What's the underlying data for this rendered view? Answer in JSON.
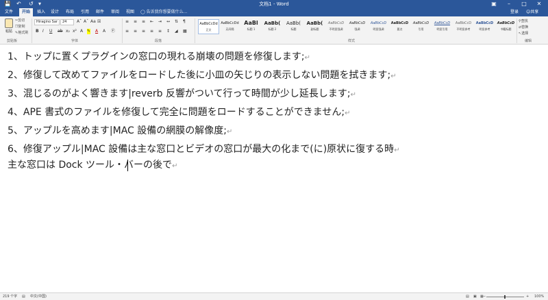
{
  "window": {
    "title": "文档1 - Word",
    "quick_access": [
      "save-icon",
      "undo-icon",
      "redo-icon",
      "customize-icon"
    ],
    "controls": [
      "ribbon-display-icon",
      "minimize-icon",
      "restore-icon",
      "close-icon"
    ]
  },
  "tabs": [
    {
      "label": "文件",
      "active": false
    },
    {
      "label": "开始",
      "active": true
    },
    {
      "label": "插入",
      "active": false
    },
    {
      "label": "设计",
      "active": false
    },
    {
      "label": "布局",
      "active": false
    },
    {
      "label": "引用",
      "active": false
    },
    {
      "label": "邮件",
      "active": false
    },
    {
      "label": "审阅",
      "active": false
    },
    {
      "label": "视图",
      "active": false
    }
  ],
  "tell_me": "告诉我你想要做什么...",
  "account": {
    "sign_in": "登录",
    "share": "共享"
  },
  "ribbon": {
    "clipboard": {
      "paste": "粘贴",
      "cut": "剪切",
      "copy": "复制",
      "format_painter": "格式刷",
      "label": "剪贴板"
    },
    "font": {
      "font_name": "Hiragino Sar",
      "font_size": "24",
      "label": "字体"
    },
    "paragraph": {
      "label": "段落"
    },
    "styles": {
      "label": "样式",
      "items": [
        {
          "preview": "AaBbCcDd",
          "name": "正文",
          "active": true
        },
        {
          "preview": "AaBbCcDd",
          "name": "无间隔",
          "active": false
        },
        {
          "preview": "AaBl",
          "name": "标题 1",
          "active": false,
          "big": true
        },
        {
          "preview": "AaBb(",
          "name": "标题 2",
          "active": false
        },
        {
          "preview": "AaBb(",
          "name": "标题",
          "active": false
        },
        {
          "preview": "AaBb(",
          "name": "副标题",
          "active": false
        },
        {
          "preview": "AaBbCcD",
          "name": "不明显强调",
          "active": false
        },
        {
          "preview": "AaBbCcD",
          "name": "强调",
          "active": false
        },
        {
          "preview": "AaBbCcD",
          "name": "明显强调",
          "active": false
        },
        {
          "preview": "AaBbCcD",
          "name": "要点",
          "active": false
        },
        {
          "preview": "AaBbCcD",
          "name": "引用",
          "active": false
        },
        {
          "preview": "AaBbCcD",
          "name": "明显引用",
          "active": false
        },
        {
          "preview": "AaBbCcD",
          "name": "不明显参考",
          "active": false
        },
        {
          "preview": "AaBbCcD",
          "name": "明显参考",
          "active": false
        },
        {
          "preview": "AaBbCcD",
          "name": "书籍标题",
          "active": false
        }
      ]
    },
    "editing": {
      "find": "查找",
      "replace": "替换",
      "select": "选择",
      "label": "编辑"
    }
  },
  "document": {
    "paragraphs": [
      "1、トップに置くプラグインの窓口の現れる崩壊の問題を修復します;",
      "2、修復して改めてファイルをロードした後に小皿の矢じりの表示しない問題を拭きます;",
      "3、混じるのがよく響きます|reverb 反響がついて行って時間が少し延長します;",
      "4、APE 書式のファイルを修復して完全に問題をロードすることができません;",
      "5、アップルを高めます|MAC 設備の網膜の解像度;",
      "6、修復アップル|MAC 設備は主な窓口とビデオの窓口が最大の化まで(に)原状に復する時",
      "主な窓口は Dock ツール・バーの後で"
    ]
  },
  "status": {
    "word_count": "219 个字",
    "language": "中文(中国)",
    "zoom": "100%",
    "zoom_level": 1.0
  }
}
